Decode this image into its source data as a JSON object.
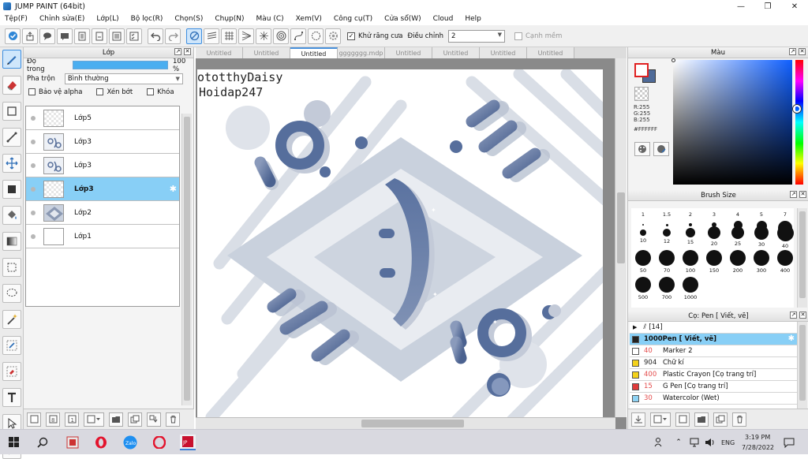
{
  "window": {
    "title": "JUMP PAINT (64bit)",
    "minimize": "—",
    "maximize": "❐",
    "close": "✕"
  },
  "menu": [
    "Tệp(F)",
    "Chỉnh sửa(E)",
    "Lớp(L)",
    "Bộ lọc(R)",
    "Chọn(S)",
    "Chụp(N)",
    "Màu (C)",
    "Xem(V)",
    "Công cụ(T)",
    "Cửa sổ(W)",
    "Cloud",
    "Help"
  ],
  "toolbar": {
    "antialias_label": "Khử răng cưa",
    "antialias_checked": "✓",
    "adjust_label": "Điều chỉnh",
    "adjust_value": "2",
    "smooth_label": "Cạnh mềm"
  },
  "layer_panel": {
    "title": "Lớp",
    "opacity_label": "Độ trong",
    "opacity_value": "100 %",
    "opacity_fraction": 1.0,
    "blend_label": "Pha trộn",
    "blend_value": "Bình thường",
    "protect_alpha": "Bảo vệ alpha",
    "clip": "Xén bớt",
    "lock": "Khóa",
    "layers": [
      {
        "name": "Lớp5",
        "thumb": "empty",
        "selected": false
      },
      {
        "name": "Lớp3",
        "thumb": "art",
        "selected": false
      },
      {
        "name": "Lớp3",
        "thumb": "art",
        "selected": false
      },
      {
        "name": "Lớp3",
        "thumb": "empty",
        "selected": true
      },
      {
        "name": "Lớp2",
        "thumb": "diamond",
        "selected": false
      },
      {
        "name": "Lớp1",
        "thumb": "white",
        "selected": false
      }
    ]
  },
  "tabs": [
    {
      "label": "Untitled",
      "active": false
    },
    {
      "label": "Untitled",
      "active": false
    },
    {
      "label": "Untitled",
      "active": true
    },
    {
      "label": "ggggggg.mdp",
      "active": false
    },
    {
      "label": "Untitled",
      "active": false
    },
    {
      "label": "Untitled",
      "active": false
    },
    {
      "label": "Untitled",
      "active": false
    },
    {
      "label": "Untitled",
      "active": false
    }
  ],
  "canvas": {
    "watermark_line1": "ototthyDaisy",
    "watermark_line2": "Hoidap247"
  },
  "color_panel": {
    "title": "Màu",
    "r": "R:255",
    "g": "G:255",
    "b": "B:255",
    "hex": "#FFFFFF",
    "fg_color": "#FFFFFF",
    "bg_color": "#4E6A98"
  },
  "brush_size": {
    "title": "Brush Size",
    "sizes": [
      "1",
      "1.5",
      "2",
      "3",
      "4",
      "5",
      "7",
      "10",
      "12",
      "15",
      "20",
      "25",
      "30",
      "40",
      "50",
      "70",
      "100",
      "150",
      "200",
      "300",
      "400",
      "500",
      "700",
      "1000"
    ]
  },
  "brush_list": {
    "title": "Cọ: Pen [ Viết, vẽ]",
    "folder": "[14]",
    "items": [
      {
        "num": "",
        "name": "1000Pen [ Viết, vẽ]",
        "color": "#222222",
        "selected": true
      },
      {
        "num": "40",
        "name": "Marker 2",
        "color": "#ffffff",
        "selected": false
      },
      {
        "num": "904",
        "name": "Chữ kí",
        "color": "#f4d21a",
        "selected": false
      },
      {
        "num": "400",
        "name": "Plastic Crayon [Cọ trang trí]",
        "color": "#f4d21a",
        "selected": false
      },
      {
        "num": "15",
        "name": "G Pen [Cọ trang trí]",
        "color": "#e03b3b",
        "selected": false
      },
      {
        "num": "30",
        "name": "Watercolor (Wet)",
        "color": "#8fd3f4",
        "selected": false
      }
    ]
  },
  "taskbar": {
    "lang": "ENG",
    "time": "3:19 PM",
    "date": "7/28/2022"
  }
}
